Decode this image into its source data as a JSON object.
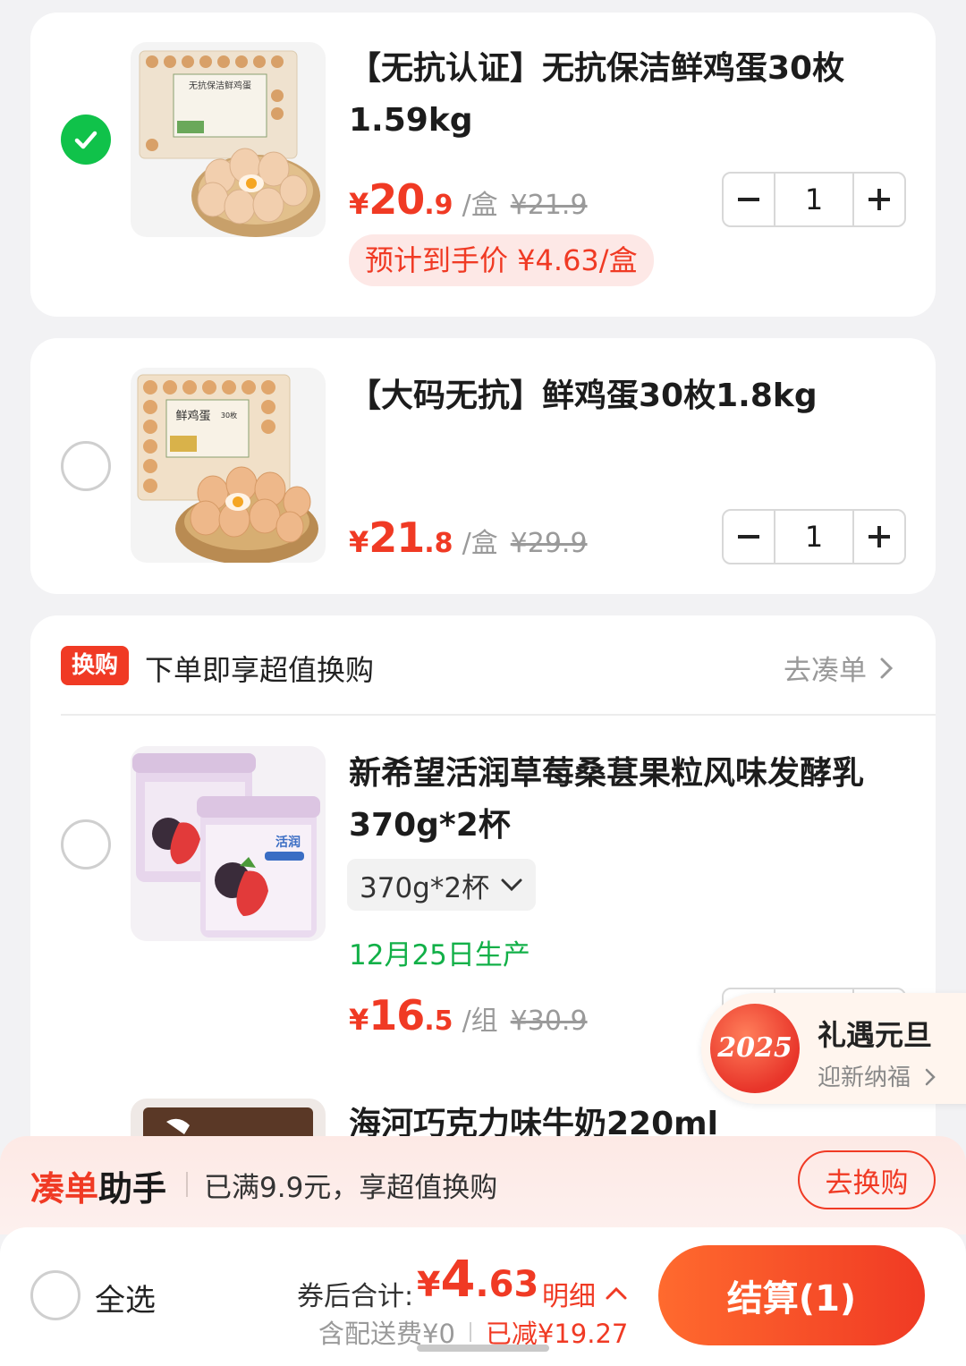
{
  "items": [
    {
      "title": "【无抗认证】无抗保洁鲜鸡蛋30枚1.59kg",
      "price_currency": "¥",
      "price_int": "20",
      "price_dec": ".9",
      "unit": "/盒",
      "original_price": "¥21.9",
      "quantity": "1",
      "estimate": "预计到手价 ¥4.63/盒",
      "selected": true,
      "thumb_label": "无抗保洁鲜鸡蛋"
    },
    {
      "title": "【大码无抗】鲜鸡蛋30枚1.8kg",
      "price_currency": "¥",
      "price_int": "21",
      "price_dec": ".8",
      "unit": "/盒",
      "original_price": "¥29.9",
      "quantity": "1",
      "selected": false,
      "thumb_label": "鲜鸡蛋",
      "thumb_sub": "30枚"
    }
  ],
  "swap_section": {
    "tag": "换购",
    "text": "下单即享超值换购",
    "link": "去凑单",
    "items": [
      {
        "title": "新希望活润草莓桑葚果粒风味发酵乳370g*2杯",
        "spec": "370g*2杯",
        "production": "12月25日生产",
        "price_currency": "¥",
        "price_int": "16",
        "price_dec": ".5",
        "unit": "/组",
        "original_price": "¥30.9",
        "thumb_label": "活润"
      },
      {
        "title": "海河巧克力味牛奶220ml"
      }
    ]
  },
  "promo": {
    "badge": "2025",
    "title": "礼遇元旦",
    "subtitle": "迎新纳福"
  },
  "helper": {
    "name_a": "凑单",
    "name_b": "助手",
    "message": "已满9.9元，享超值换购",
    "button": "去换购"
  },
  "bottom_bar": {
    "select_all": "全选",
    "total_label": "券后合计:",
    "total_currency": "¥",
    "total_int": "4",
    "total_dec": ".63",
    "detail": "明细",
    "shipping": "含配送费¥0",
    "discount": "已减¥19.27",
    "checkout": "结算(1)"
  },
  "colors": {
    "accent": "#f03a24",
    "checked": "#10c24a",
    "green_text": "#12b048"
  }
}
